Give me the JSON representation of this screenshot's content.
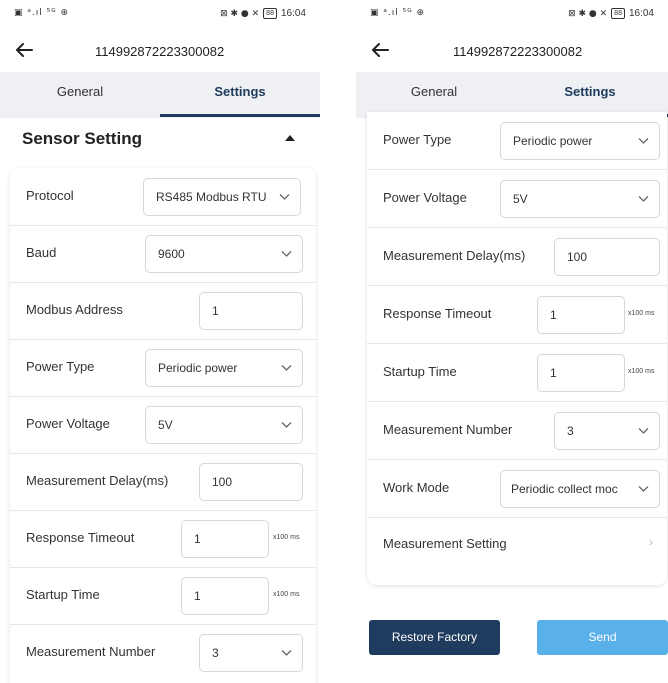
{
  "status_bar": {
    "left_icons": "▣ ᵃ.ıl ⁵ᴳ ⊕",
    "right_icons": "⊠ ✱ ● ✕",
    "battery": "88",
    "time": "16:04"
  },
  "header": {
    "title": "114992872223300082"
  },
  "tabs": [
    {
      "label": "General"
    },
    {
      "label": "Settings"
    }
  ],
  "section": {
    "title": "Sensor Setting"
  },
  "left_rows": [
    {
      "label": "Protocol",
      "value": "RS485 Modbus RTU"
    },
    {
      "label": "Baud",
      "value": "9600"
    },
    {
      "label": "Modbus Address",
      "value": "1"
    },
    {
      "label": "Power Type",
      "value": "Periodic power"
    },
    {
      "label": "Power Voltage",
      "value": "5V"
    },
    {
      "label": "Measurement Delay(ms)",
      "value": "100"
    },
    {
      "label": "Response Timeout",
      "value": "1",
      "unit": "x100 ms"
    },
    {
      "label": "Startup Time",
      "value": "1",
      "unit": "x100 ms"
    },
    {
      "label": "Measurement Number",
      "value": "3"
    }
  ],
  "right_rows": [
    {
      "label": "Power Type",
      "value": "Periodic power"
    },
    {
      "label": "Power Voltage",
      "value": "5V"
    },
    {
      "label": "Measurement Delay(ms)",
      "value": "100"
    },
    {
      "label": "Response Timeout",
      "value": "1",
      "unit": "x100 ms"
    },
    {
      "label": "Startup Time",
      "value": "1",
      "unit": "x100 ms"
    },
    {
      "label": "Measurement Number",
      "value": "3"
    },
    {
      "label": "Work Mode",
      "value": "Periodic collect moc"
    },
    {
      "label": "Measurement Setting",
      "chevron": "›"
    }
  ],
  "buttons": {
    "restore": "Restore Factory",
    "send": "Send"
  },
  "colors": {
    "primary": "#1f3b5d",
    "send": "#5ab0e8",
    "tab_bg": "#eef0f4"
  }
}
